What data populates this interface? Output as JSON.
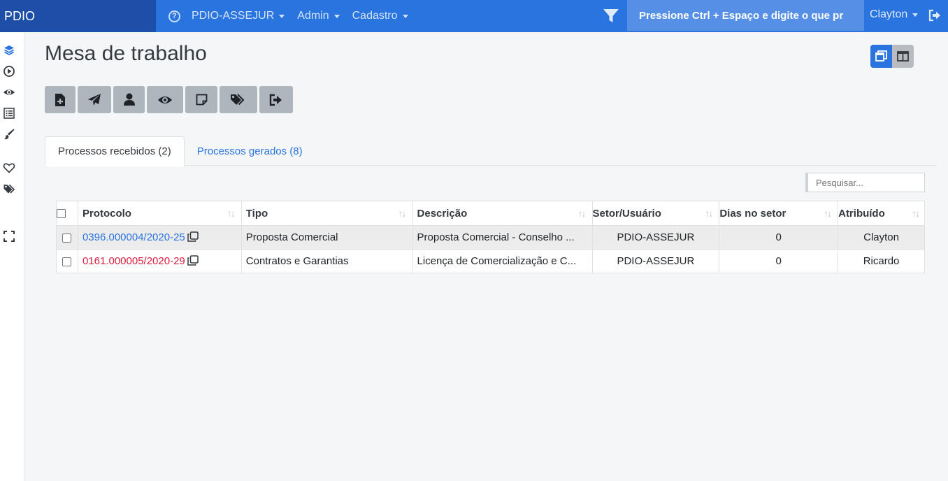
{
  "brand": "PDIO",
  "nav": {
    "help_icon": "question-circle-icon",
    "menus": [
      {
        "label": "PDIO-ASSEJUR"
      },
      {
        "label": "Admin"
      },
      {
        "label": "Cadastro"
      }
    ],
    "filter_icon": "filter-icon",
    "quick_search_text": "Pressione Ctrl + Espaço e digite o que pr",
    "user": "Clayton",
    "logout_icon": "sign-out-icon"
  },
  "sidebar": {
    "icons": [
      "layers-icon",
      "play-circle-icon",
      "eye-icon",
      "list-icon",
      "brush-icon",
      "heart-icon",
      "tags-icon",
      "expand-icon"
    ]
  },
  "page": {
    "title": "Mesa de trabalho"
  },
  "view_toggle": {
    "icons": [
      "windows-icon",
      "columns-icon"
    ],
    "active_index": 0
  },
  "toolbar": {
    "buttons": [
      "file-plus-icon",
      "paper-plane-icon",
      "user-icon",
      "eye-icon",
      "sticky-note-icon",
      "tags-icon",
      "sign-out-icon"
    ]
  },
  "tabs": [
    {
      "label": "Processos recebidos (2)",
      "active": true
    },
    {
      "label": "Processos gerados (8)",
      "active": false
    }
  ],
  "search": {
    "placeholder": "Pesquisar..."
  },
  "table": {
    "columns": [
      "Protocolo",
      "Tipo",
      "Descrição",
      "Setor/Usuário",
      "Dias no setor",
      "Atribuído"
    ],
    "rows": [
      {
        "protocolo": "0396.000004/2020-25",
        "tipo": "Proposta Comercial",
        "descricao": "Proposta Comercial - Conselho ...",
        "setor": "PDIO-ASSEJUR",
        "dias": "0",
        "atribuido": "Clayton"
      },
      {
        "protocolo": "0161.000005/2020-29",
        "tipo": "Contratos e Garantias",
        "descricao": "Licença de Comercialização e C...",
        "setor": "PDIO-ASSEJUR",
        "dias": "0",
        "atribuido": "Ricardo"
      }
    ]
  },
  "colors": {
    "navbar": "#2a74e0",
    "brand_bg": "#1d4fa8",
    "link_blue": "#2a74e0",
    "protocol_red": "#dc1e3e",
    "tool_button": "#adb5bd"
  }
}
